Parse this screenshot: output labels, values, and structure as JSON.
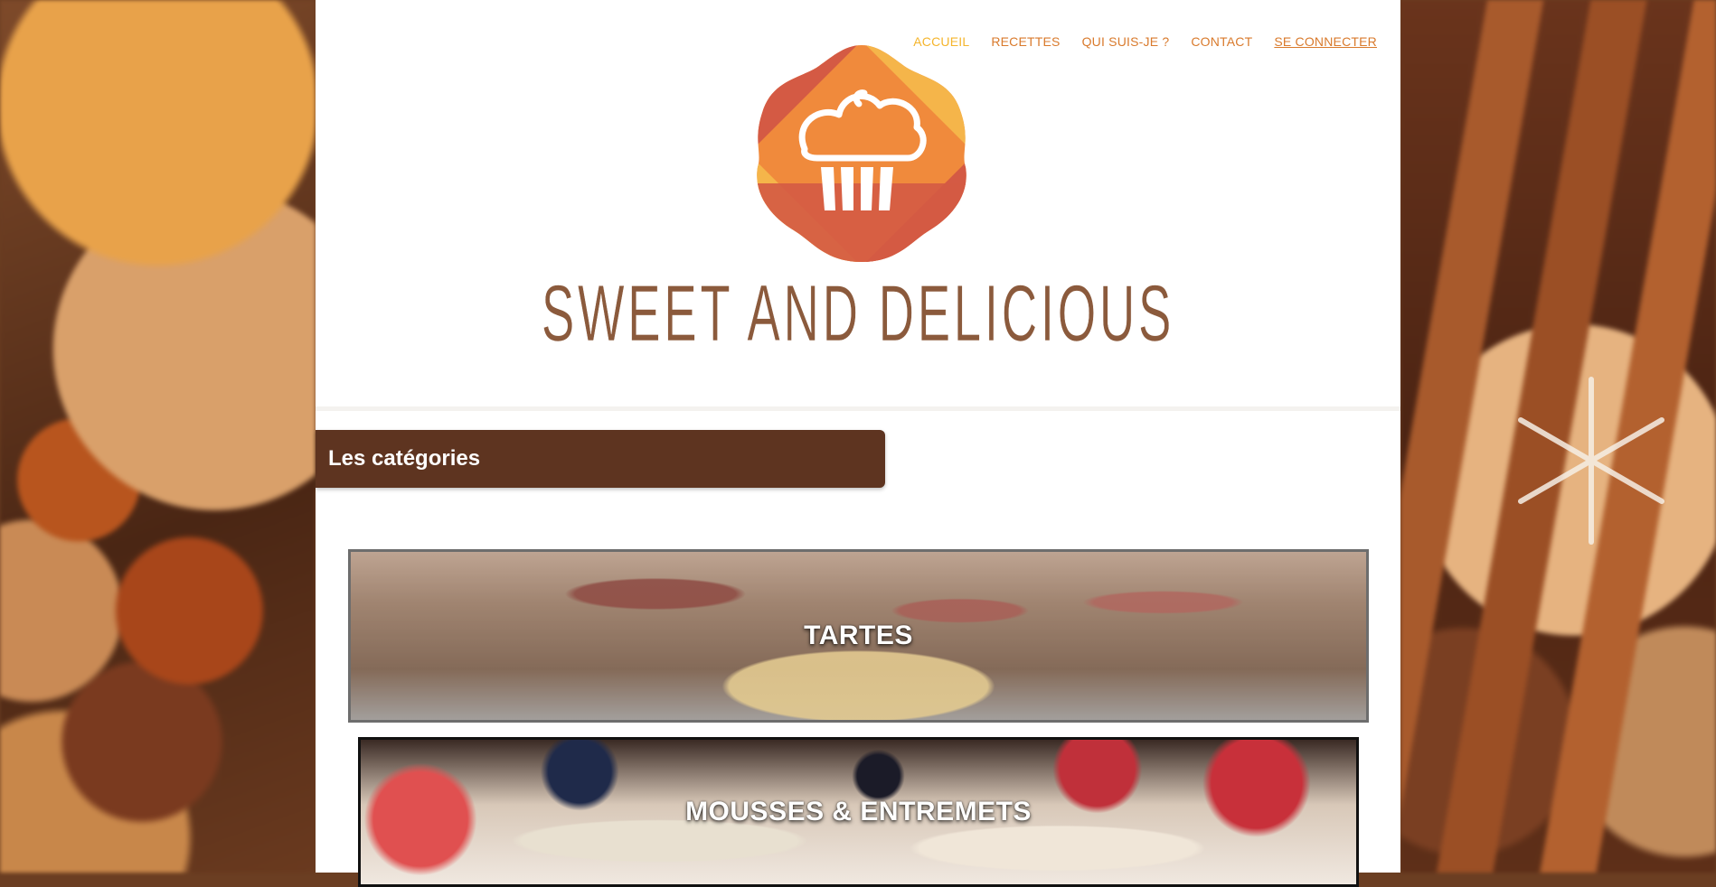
{
  "nav": {
    "items": [
      {
        "label": "ACCUEIL"
      },
      {
        "label": "RECETTES"
      },
      {
        "label": "QUI SUIS-JE ?"
      },
      {
        "label": "CONTACT"
      },
      {
        "label": "SE CONNECTER"
      }
    ]
  },
  "brand": {
    "logo_icon": "cupcake-icon",
    "name": "SWEET AND DELICIOUS"
  },
  "categories": {
    "title": "Les catégories",
    "items": [
      {
        "label": "TARTES"
      },
      {
        "label": "MOUSSES & ENTREMETS"
      }
    ]
  },
  "colors": {
    "nav_link": "#d97a2c",
    "nav_active": "#f5b52c",
    "brand_text": "#8b5a3c",
    "category_header_bg": "#5e3420",
    "logo_orange": "#f08a3c",
    "logo_red": "#d45a44",
    "logo_yellow": "#f5b54a"
  }
}
